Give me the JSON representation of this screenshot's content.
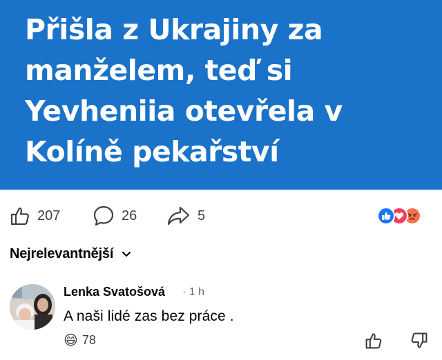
{
  "post": {
    "headline_lines": [
      "Přišla z Ukrajiny za",
      "manželem, teď si",
      "Yevheniia otevřela v",
      "Kolíně pekařství"
    ],
    "colors": {
      "banner": "#1a73c8",
      "text": "#ffffff"
    }
  },
  "actions": {
    "likes": "207",
    "comments": "26",
    "shares": "5",
    "reaction_icons": [
      "like-reaction-icon",
      "love-reaction-icon",
      "angry-reaction-icon"
    ]
  },
  "sort": {
    "label": "Nejrelevantnější"
  },
  "comment": {
    "author": "Lenka Svatošová",
    "time": "· 1 h",
    "text": "A naši lidé zas bez práce .",
    "reaction_emoji": "😄",
    "reaction_count": "78"
  }
}
